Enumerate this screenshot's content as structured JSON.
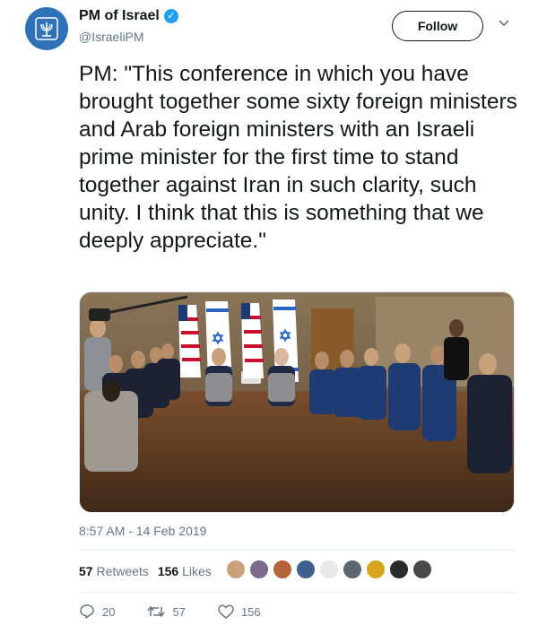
{
  "header": {
    "name": "PM of Israel",
    "handle": "@IsraeliPM",
    "follow_label": "Follow"
  },
  "tweet": {
    "text": "PM: \"This conference in which you have brought together some sixty foreign ministers and Arab foreign ministers with an Israeli prime minister for the first time to stand together against Iran in such clarity, such unity. I think that this is something that we deeply appreciate.\"",
    "timestamp": "8:57 AM - 14 Feb 2019"
  },
  "stats": {
    "retweets_count": "57",
    "retweets_label": "Retweets",
    "likes_count": "156",
    "likes_label": "Likes"
  },
  "actions": {
    "reply_count": "20",
    "retweet_count": "57",
    "like_count": "156"
  },
  "colors": {
    "accent": "#1da1f2",
    "avatar_bg": "#2f72b8",
    "secondary_text": "#657786"
  },
  "icons": [
    "verified-badge-icon",
    "chevron-down-icon",
    "reply-icon",
    "retweet-icon",
    "like-icon"
  ]
}
